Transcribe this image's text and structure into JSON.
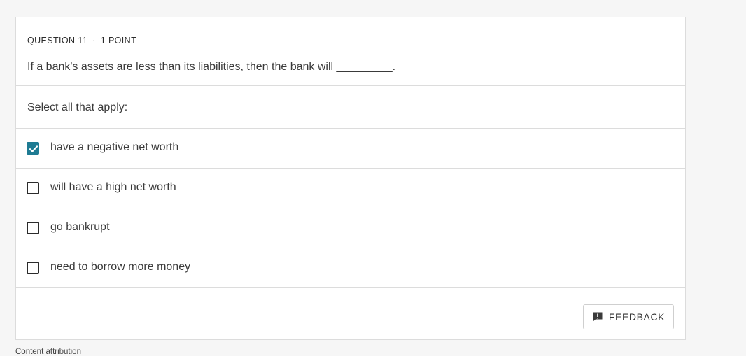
{
  "question": {
    "number_label": "QUESTION 11",
    "separator": "·",
    "points_label": "1 POINT",
    "text": "If a bank's assets are less than its liabilities, then the bank will _________."
  },
  "instruction": "Select all that apply:",
  "options": [
    {
      "label": "have a negative net worth",
      "checked": true
    },
    {
      "label": "will have a high net worth",
      "checked": false
    },
    {
      "label": "go bankrupt",
      "checked": false
    },
    {
      "label": "need to borrow more money",
      "checked": false
    }
  ],
  "feedback": {
    "label": "FEEDBACK",
    "icon": "feedback-icon"
  },
  "attribution": "Content attribution",
  "colors": {
    "accent": "#1e7b93",
    "border": "#dcdcdc",
    "background": "#f6f6f6"
  }
}
